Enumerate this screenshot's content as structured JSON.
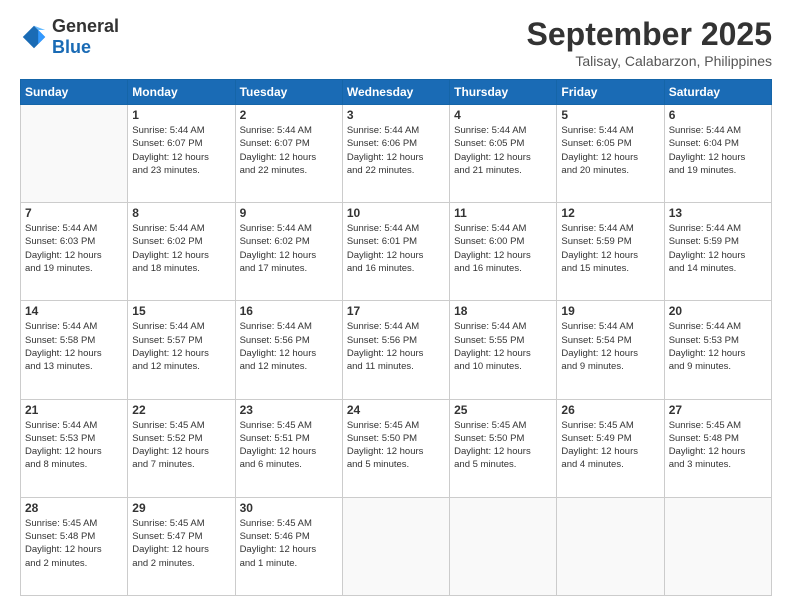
{
  "header": {
    "logo": {
      "general": "General",
      "blue": "Blue"
    },
    "month_title": "September 2025",
    "location": "Talisay, Calabarzon, Philippines"
  },
  "calendar": {
    "days_of_week": [
      "Sunday",
      "Monday",
      "Tuesday",
      "Wednesday",
      "Thursday",
      "Friday",
      "Saturday"
    ],
    "weeks": [
      [
        {
          "day": "",
          "info": ""
        },
        {
          "day": "1",
          "info": "Sunrise: 5:44 AM\nSunset: 6:07 PM\nDaylight: 12 hours\nand 23 minutes."
        },
        {
          "day": "2",
          "info": "Sunrise: 5:44 AM\nSunset: 6:07 PM\nDaylight: 12 hours\nand 22 minutes."
        },
        {
          "day": "3",
          "info": "Sunrise: 5:44 AM\nSunset: 6:06 PM\nDaylight: 12 hours\nand 22 minutes."
        },
        {
          "day": "4",
          "info": "Sunrise: 5:44 AM\nSunset: 6:05 PM\nDaylight: 12 hours\nand 21 minutes."
        },
        {
          "day": "5",
          "info": "Sunrise: 5:44 AM\nSunset: 6:05 PM\nDaylight: 12 hours\nand 20 minutes."
        },
        {
          "day": "6",
          "info": "Sunrise: 5:44 AM\nSunset: 6:04 PM\nDaylight: 12 hours\nand 19 minutes."
        }
      ],
      [
        {
          "day": "7",
          "info": "Sunrise: 5:44 AM\nSunset: 6:03 PM\nDaylight: 12 hours\nand 19 minutes."
        },
        {
          "day": "8",
          "info": "Sunrise: 5:44 AM\nSunset: 6:02 PM\nDaylight: 12 hours\nand 18 minutes."
        },
        {
          "day": "9",
          "info": "Sunrise: 5:44 AM\nSunset: 6:02 PM\nDaylight: 12 hours\nand 17 minutes."
        },
        {
          "day": "10",
          "info": "Sunrise: 5:44 AM\nSunset: 6:01 PM\nDaylight: 12 hours\nand 16 minutes."
        },
        {
          "day": "11",
          "info": "Sunrise: 5:44 AM\nSunset: 6:00 PM\nDaylight: 12 hours\nand 16 minutes."
        },
        {
          "day": "12",
          "info": "Sunrise: 5:44 AM\nSunset: 5:59 PM\nDaylight: 12 hours\nand 15 minutes."
        },
        {
          "day": "13",
          "info": "Sunrise: 5:44 AM\nSunset: 5:59 PM\nDaylight: 12 hours\nand 14 minutes."
        }
      ],
      [
        {
          "day": "14",
          "info": "Sunrise: 5:44 AM\nSunset: 5:58 PM\nDaylight: 12 hours\nand 13 minutes."
        },
        {
          "day": "15",
          "info": "Sunrise: 5:44 AM\nSunset: 5:57 PM\nDaylight: 12 hours\nand 12 minutes."
        },
        {
          "day": "16",
          "info": "Sunrise: 5:44 AM\nSunset: 5:56 PM\nDaylight: 12 hours\nand 12 minutes."
        },
        {
          "day": "17",
          "info": "Sunrise: 5:44 AM\nSunset: 5:56 PM\nDaylight: 12 hours\nand 11 minutes."
        },
        {
          "day": "18",
          "info": "Sunrise: 5:44 AM\nSunset: 5:55 PM\nDaylight: 12 hours\nand 10 minutes."
        },
        {
          "day": "19",
          "info": "Sunrise: 5:44 AM\nSunset: 5:54 PM\nDaylight: 12 hours\nand 9 minutes."
        },
        {
          "day": "20",
          "info": "Sunrise: 5:44 AM\nSunset: 5:53 PM\nDaylight: 12 hours\nand 9 minutes."
        }
      ],
      [
        {
          "day": "21",
          "info": "Sunrise: 5:44 AM\nSunset: 5:53 PM\nDaylight: 12 hours\nand 8 minutes."
        },
        {
          "day": "22",
          "info": "Sunrise: 5:45 AM\nSunset: 5:52 PM\nDaylight: 12 hours\nand 7 minutes."
        },
        {
          "day": "23",
          "info": "Sunrise: 5:45 AM\nSunset: 5:51 PM\nDaylight: 12 hours\nand 6 minutes."
        },
        {
          "day": "24",
          "info": "Sunrise: 5:45 AM\nSunset: 5:50 PM\nDaylight: 12 hours\nand 5 minutes."
        },
        {
          "day": "25",
          "info": "Sunrise: 5:45 AM\nSunset: 5:50 PM\nDaylight: 12 hours\nand 5 minutes."
        },
        {
          "day": "26",
          "info": "Sunrise: 5:45 AM\nSunset: 5:49 PM\nDaylight: 12 hours\nand 4 minutes."
        },
        {
          "day": "27",
          "info": "Sunrise: 5:45 AM\nSunset: 5:48 PM\nDaylight: 12 hours\nand 3 minutes."
        }
      ],
      [
        {
          "day": "28",
          "info": "Sunrise: 5:45 AM\nSunset: 5:48 PM\nDaylight: 12 hours\nand 2 minutes."
        },
        {
          "day": "29",
          "info": "Sunrise: 5:45 AM\nSunset: 5:47 PM\nDaylight: 12 hours\nand 2 minutes."
        },
        {
          "day": "30",
          "info": "Sunrise: 5:45 AM\nSunset: 5:46 PM\nDaylight: 12 hours\nand 1 minute."
        },
        {
          "day": "",
          "info": ""
        },
        {
          "day": "",
          "info": ""
        },
        {
          "day": "",
          "info": ""
        },
        {
          "day": "",
          "info": ""
        }
      ]
    ]
  }
}
